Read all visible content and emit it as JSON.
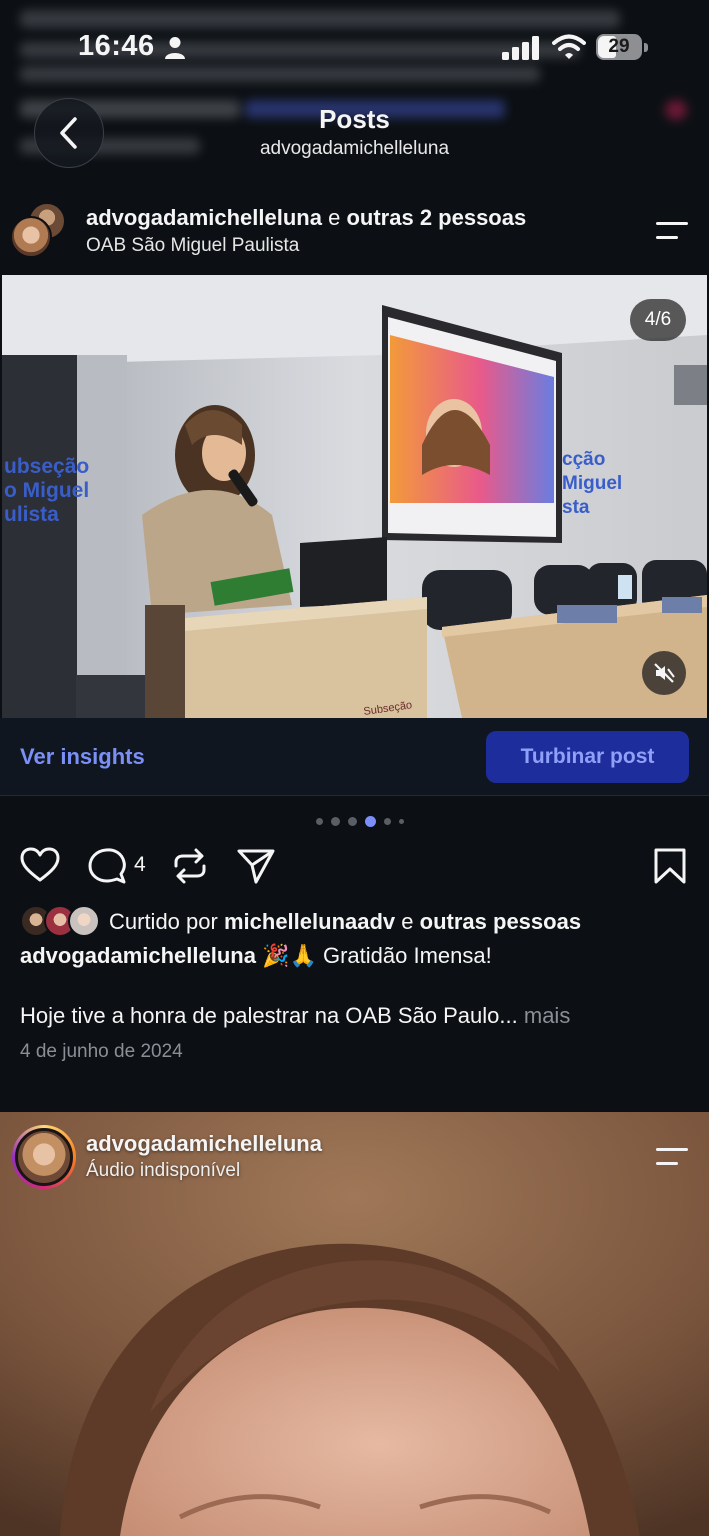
{
  "status_bar": {
    "time": "16:46",
    "battery": "29"
  },
  "header": {
    "title": "Posts",
    "subtitle": "advogadamichelleluna"
  },
  "post1": {
    "author": "advogadamichelleluna",
    "coauthors_text": "e",
    "coauthors_bold": "outras 2 pessoas",
    "location": "OAB São Miguel Paulista",
    "media_counter": "4/6",
    "media_sign_left": "Subseção\nSão Miguel\nPaulista",
    "media_sign_bottom": "Subseção",
    "insights_label": "Ver insights",
    "boost_label": "Turbinar post",
    "carousel": {
      "count": 6,
      "active_index": 3
    },
    "comment_count": "4",
    "liked_prefix": "Curtido por",
    "liked_user": "michellelunaadv",
    "liked_connector": "e",
    "liked_others": "outras pessoas",
    "caption_user": "advogadamichelleluna",
    "caption_text": "🎉🙏 Gratidão Imensa!",
    "caption_body": "Hoje tive a honra de palestrar na OAB São Paulo...",
    "more_label": "mais",
    "date": "4 de junho de 2024"
  },
  "post2": {
    "author": "advogadamichelleluna",
    "subtitle": "Áudio indisponível"
  },
  "colors": {
    "background": "#0c1014",
    "link_accent": "#7b8ff7",
    "boost_button": "#1d2d9c",
    "muted_text": "#8a8f96"
  },
  "icons": [
    "person-icon",
    "signal-icon",
    "wifi-icon",
    "battery-icon",
    "back-arrow-icon",
    "menu-icon",
    "mute-icon",
    "heart-icon",
    "comment-icon",
    "repost-icon",
    "share-icon",
    "bookmark-icon"
  ]
}
